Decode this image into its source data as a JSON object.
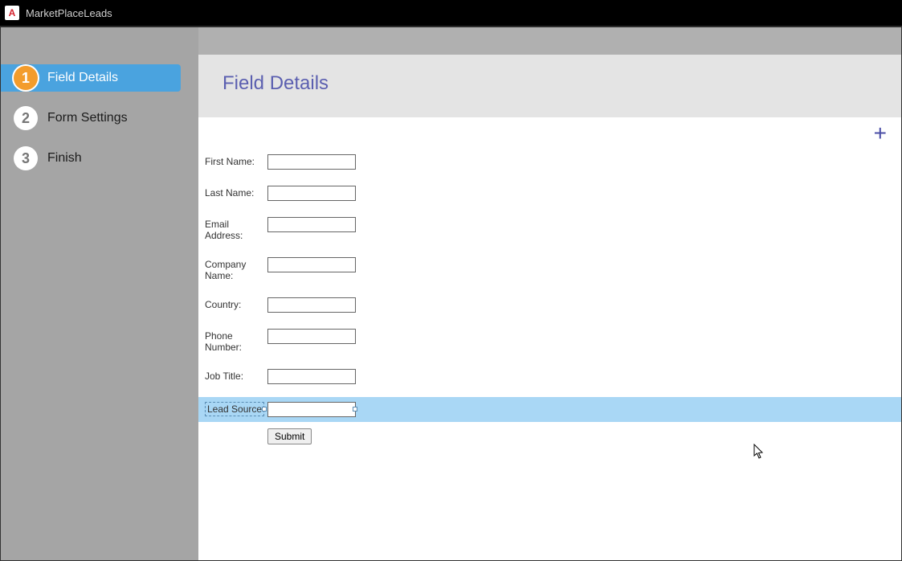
{
  "app": {
    "title": "MarketPlaceLeads"
  },
  "sidebar": {
    "steps": [
      {
        "num": "1",
        "label": "Field Details",
        "active": true
      },
      {
        "num": "2",
        "label": "Form Settings",
        "active": false
      },
      {
        "num": "3",
        "label": "Finish",
        "active": false
      }
    ]
  },
  "page": {
    "title": "Field Details"
  },
  "icons": {
    "add": "+"
  },
  "form": {
    "fields": [
      {
        "label": "First Name:",
        "value": ""
      },
      {
        "label": "Last Name:",
        "value": ""
      },
      {
        "label": "Email Address:",
        "value": ""
      },
      {
        "label": "Company Name:",
        "value": ""
      },
      {
        "label": "Country:",
        "value": ""
      },
      {
        "label": "Phone Number:",
        "value": ""
      },
      {
        "label": "Job Title:",
        "value": ""
      },
      {
        "label": "Lead Source",
        "value": "",
        "selected": true
      }
    ],
    "submit_label": "Submit"
  }
}
